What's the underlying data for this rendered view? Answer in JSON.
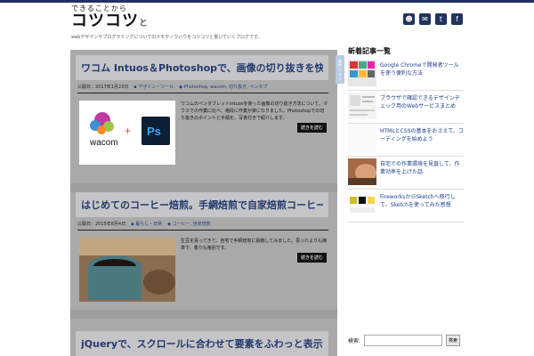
{
  "header": {
    "logo_top": "できることから",
    "logo_main": "コツコツ",
    "logo_suffix": "と",
    "tagline": "webデザインやプログラミングについてのメモやノウハウをコツコツと書いていくブログです。",
    "social_icons": [
      "user-icon",
      "mail-icon",
      "twitter-icon",
      "facebook-icon"
    ]
  },
  "posts": [
    {
      "title": "ワコム Intuos＆Photoshopで、画像の切り抜きを快適にする方法",
      "date": "公開日：2017年1月23日",
      "category": "デザイン・ツール",
      "tags": "Photoshop, wacom, 切り抜き, ペンタブ",
      "excerpt": "ワコムのペンタブレットIntuosを使った画像の切り抜き方法について。マウスでの作業に比べ、格段に作業が楽になりました。Photoshopでの切り抜きのポイントと手順を、写真付きで紹介します。",
      "thumb_text": "wacom",
      "more": "続きを読む"
    },
    {
      "title": "はじめてのコーヒー焙煎。手網焙煎で自家焙煎コーヒーを楽しむ方法",
      "date": "公開日：2015年8月4日",
      "category": "暮らし・日常",
      "tags": "コーヒー, 自家焙煎",
      "excerpt": "生豆を買ってきて、自宅で手網焙煎に挑戦してみました。思ったよりも簡単で、香りも格別です。",
      "more": "続きを読む"
    },
    {
      "title": "jQueryで、スクロールに合わせて要素をふわっと表示させる方法",
      "date": "",
      "category": "",
      "tags": "",
      "excerpt": ""
    }
  ],
  "side_tab": "全件リスト",
  "sidebar": {
    "heading": "新着記事一覧",
    "items": [
      {
        "text": "Google Chromeで開発者ツールを使う便利な方法"
      },
      {
        "text": "ブラウザで確認できるデザインチェック用のWebサービスまとめ"
      },
      {
        "text": "HTMLとCSSの基本をおさえて、コーディングを始めよう"
      },
      {
        "text": "自宅での作業環境を見直して、作業効率を上げた話"
      },
      {
        "text": "FireworksからSketchへ移行して、Sketchを使ってみた感想"
      }
    ]
  },
  "search": {
    "label": "検索:",
    "value": "",
    "button": "検索"
  }
}
